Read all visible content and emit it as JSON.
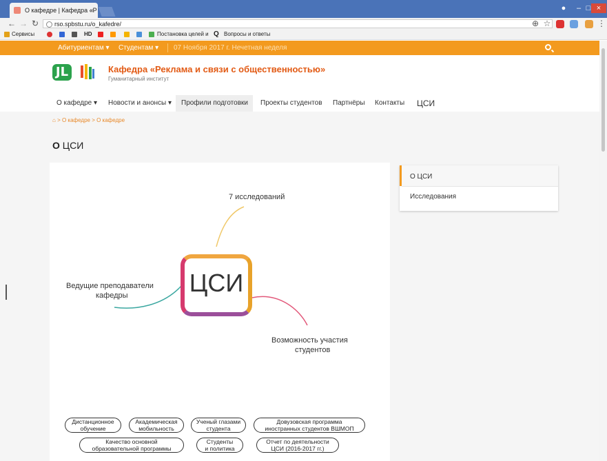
{
  "browser": {
    "tab_title": "О кафедре | Кафедра «Р",
    "tab_close": "×",
    "url": "rso.spbstu.ru/o_kafedre/",
    "bookmarks": [
      {
        "label": "Сервисы",
        "color": "#e3a21a"
      },
      {
        "label": "",
        "color": "#d33"
      },
      {
        "label": "",
        "color": "#3367d6"
      },
      {
        "label": "",
        "color": "#555"
      },
      {
        "label": "HD",
        "color": "#333"
      },
      {
        "label": "",
        "color": "#e22"
      },
      {
        "label": "",
        "color": "#f90"
      },
      {
        "label": "",
        "color": "#f4b400"
      },
      {
        "label": "",
        "color": "#4a90d9"
      },
      {
        "label": "Постановка целей и",
        "color": "#4caf50"
      },
      {
        "label": "Вопросы и ответы",
        "color": "#333"
      }
    ]
  },
  "site": {
    "topnav": {
      "applicants": "Абитуриентам ▾",
      "students": "Студентам ▾",
      "date": "07 Ноября 2017 г. Нечетная неделя"
    },
    "title": "Кафедра «Реклама и связи с общественностью»",
    "subtitle": "Гуманитарный институт",
    "logo_text": "JL",
    "nav": [
      "О кафедре ▾",
      "Новости и анонсы ▾",
      "Профили подготовки",
      "Проекты студентов",
      "Партнёры",
      "Контакты",
      "ЦСИ"
    ],
    "breadcrumb": "> О кафедре > О кафедре",
    "page_title_prefix": "О",
    "page_title_rest": " ЦСИ",
    "sidebar": [
      "О ЦСИ",
      "Исследования"
    ]
  },
  "mindmap": {
    "center": "ЦСИ",
    "top": "7 исследований",
    "left_line1": "Ведущие преподаватели",
    "left_line2": "кафедры",
    "right_line1": "Возможность участия",
    "right_line2": "студентов",
    "pills": [
      [
        "Дистанционное",
        "обучение"
      ],
      [
        "Академическая",
        "мобильность"
      ],
      [
        "Ученый глазами",
        "студента"
      ],
      [
        "Довузовская программа",
        "иностранных студентов ВШМОП"
      ],
      [
        "Качество основной",
        "образовательной программы"
      ],
      [
        "Студенты",
        "и политика"
      ],
      [
        "Отчет по деятельности",
        "ЦСИ (2016-2017 гг.)"
      ]
    ]
  },
  "colors": {
    "accent": "#f39a1e",
    "title": "#e25a14",
    "chrome": "#4a73b8"
  }
}
